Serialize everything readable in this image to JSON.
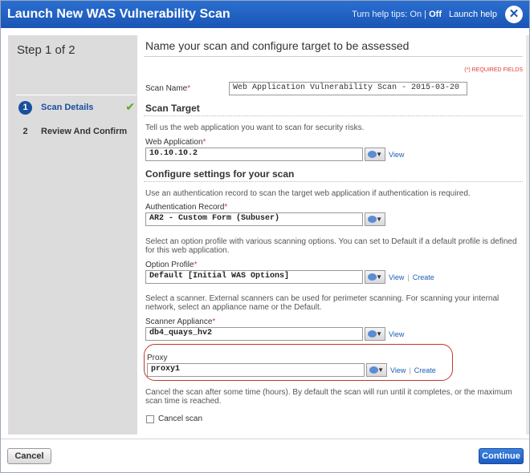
{
  "dialog": {
    "title": "Launch New WAS Vulnerability Scan",
    "help_tips_prefix": "Turn help tips:",
    "help_on": "On",
    "help_sep": "|",
    "help_off": "Off",
    "launch_help": "Launch help",
    "close_glyph": "✕"
  },
  "sidebar": {
    "step_title": "Step 1 of 2",
    "items": [
      {
        "num": "1",
        "label": "Scan Details",
        "check": "✔"
      },
      {
        "num": "2",
        "label": "Review And Confirm"
      }
    ]
  },
  "main": {
    "heading": "Name your scan and configure target to be assessed",
    "required_note": "(*) REQUIRED FIELDS",
    "scan_name_label": "Scan Name",
    "scan_name_value": "Web Application Vulnerability Scan - 2015-03-20",
    "star": "*",
    "scan_target": {
      "title": "Scan Target",
      "note": "Tell us the web application you want to scan for security risks.",
      "label": "Web Application",
      "value": "10.10.10.2",
      "view": "View"
    },
    "configure": {
      "title": "Configure settings for your scan",
      "auth_note": "Use an authentication record to scan the target web application if authentication is required.",
      "auth_label": "Authentication Record",
      "auth_value": "AR2 - Custom Form (Subuser)",
      "option_note": "Select an option profile with various scanning options. You can set to Default if a default profile is defined for this web application.",
      "option_label": "Option Profile",
      "option_value": "Default [Initial WAS Options]",
      "scanner_note": "Select a scanner. External scanners can be used for perimeter scanning. For scanning your internal network, select an appliance name or the Default.",
      "scanner_label": "Scanner Appliance",
      "scanner_value": "db4_quays_hv2",
      "proxy_label": "Proxy",
      "proxy_value": "proxy1",
      "cancel_note": "Cancel the scan after some time (hours). By default the scan will run until it completes, or the maximum scan time is reached.",
      "cancel_label": "Cancel scan",
      "view": "View",
      "create": "Create",
      "link_sep": "|"
    }
  },
  "footer": {
    "cancel": "Cancel",
    "continue": "Continue"
  },
  "colors": {
    "titlebar": "#1a55b5",
    "accent": "#1a4fa0",
    "required": "#e03a3a",
    "highlight_ring": "#c0392b",
    "check": "#5aa628"
  }
}
